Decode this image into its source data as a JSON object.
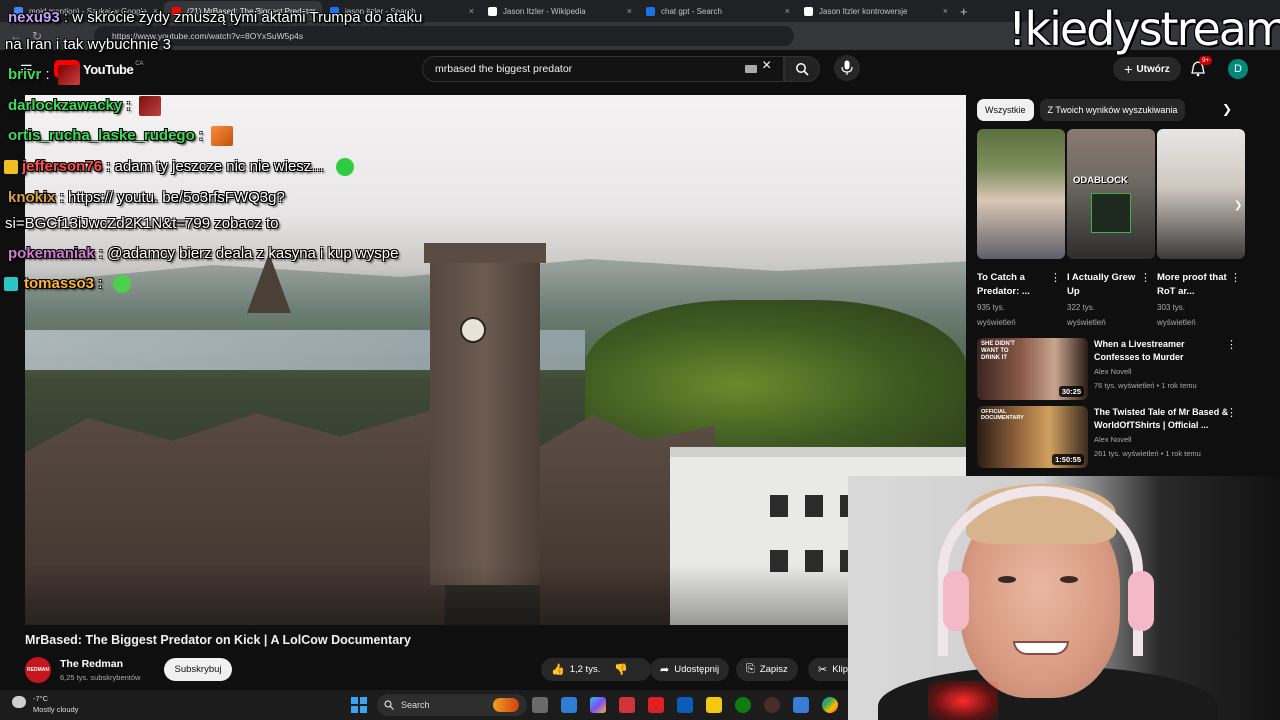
{
  "browser": {
    "tabs": [
      {
        "label": "moid mention) - Szukaj w Google",
        "color": "#4285f4"
      },
      {
        "label": "(21) MrBased: The Biggest Predator",
        "color": "#ff0000"
      },
      {
        "label": "jason itzler - Search",
        "color": "#1a73e8"
      },
      {
        "label": "Jason Itzler - Wikipedia",
        "color": "#ffffff"
      },
      {
        "label": "chat gpt - Search",
        "color": "#1a73e8"
      },
      {
        "label": "Jason Itzler kontrowersje",
        "color": "#ffffff"
      }
    ],
    "close_glyph": "×",
    "new_tab_glyph": "+",
    "url": "https://www.youtube.com/watch?v=8OYxSuW5p4s"
  },
  "youtube": {
    "logo_text": "YouTube",
    "country": "CA",
    "search_query": "mrbased the biggest predator",
    "create_label": "Utwórz",
    "notif_count": "9+",
    "avatar_letter": "D"
  },
  "video": {
    "title": "MrBased: The Biggest Predator on Kick | A LolCow Documentary",
    "channel": "The Redman",
    "channel_avatar_text": "REDMAN",
    "subscribers": "6,25 tys. subskrybentów",
    "subscribe_label": "Subskrybuj",
    "likes": "1,2 tys.",
    "share_label": "Udostępnij",
    "save_label": "Zapisz",
    "clip_label": "Klip"
  },
  "sidebar": {
    "chips": [
      "Wszystkie",
      "Z Twoich wyników wyszukiwania"
    ],
    "shorts": [
      {
        "title": "To Catch a Predator: ...",
        "views": "935 tys.",
        "views_unit": "wyświetleń",
        "colors": [
          "#5b6f3e",
          "#d9c7b5"
        ]
      },
      {
        "title": "I Actually Grew Up",
        "views": "322 tys.",
        "views_unit": "wyświetleń",
        "overlay": "ODABLOCK",
        "colors": [
          "#6e6a62",
          "#2d2d2d"
        ]
      },
      {
        "title": "More proof that RoT ar...",
        "views": "303 tys.",
        "views_unit": "wyświetleń",
        "colors": [
          "#e6e6e6",
          "#3a3a3a"
        ]
      }
    ],
    "recommended": [
      {
        "title": "When a Livestreamer Confesses to Murder",
        "channel": "Alex Novell",
        "meta": "76 tys. wyświetleń • 1 rok temu",
        "duration": "30:25",
        "thumb_text": "SHE DIDN'T WANT TO DRINK IT"
      },
      {
        "title": "The Twisted Tale of Mr Based & WorldOfTShirts | Official ...",
        "channel": "Alex Novell",
        "meta": "261 tys. wyświetleń • 1 rok temu",
        "duration": "1:50:55",
        "thumb_text": "OFFICIAL DOCUMENTARY"
      }
    ]
  },
  "overlay": {
    "brand": "!kiedystream",
    "chat": [
      {
        "user": "nexu93",
        "color": "#c9a0ff",
        "text": " : w skrócie żydy zmuszą tymi aktami Trumpa do ataku",
        "cont": "na Iran i tak wybuchnie 3"
      },
      {
        "user": "brivr",
        "color": "#3ddc55",
        "text": " :"
      },
      {
        "user": "darlockzawacky",
        "color": "#3ddc55",
        "text": " :"
      },
      {
        "user": "ortis_rucha_laske_rudego",
        "color": "#3ddc55",
        "text": " :"
      },
      {
        "user": "jefferson76",
        "color": "#ff4f4f",
        "text": " : adam ty jeszcze nic nie wiesz..."
      },
      {
        "user": "knokix",
        "color": "#d9a440",
        "text": " : https:// youtu. be/5o3rfsFWQ3g?",
        "cont": "si=BGCf13iJwcZd2K1N&t=799 zobacz to"
      },
      {
        "user": "pokemaniak",
        "color": "#d07cd0",
        "text": " : @adamcy bierz deala z kasyna i kup wyspe"
      },
      {
        "user": "tomasso3",
        "color": "#ffb833",
        "text": " :"
      }
    ]
  },
  "taskbar": {
    "temperature": "-7°C",
    "condition": "Mostly cloudy",
    "search_label": "Search"
  }
}
